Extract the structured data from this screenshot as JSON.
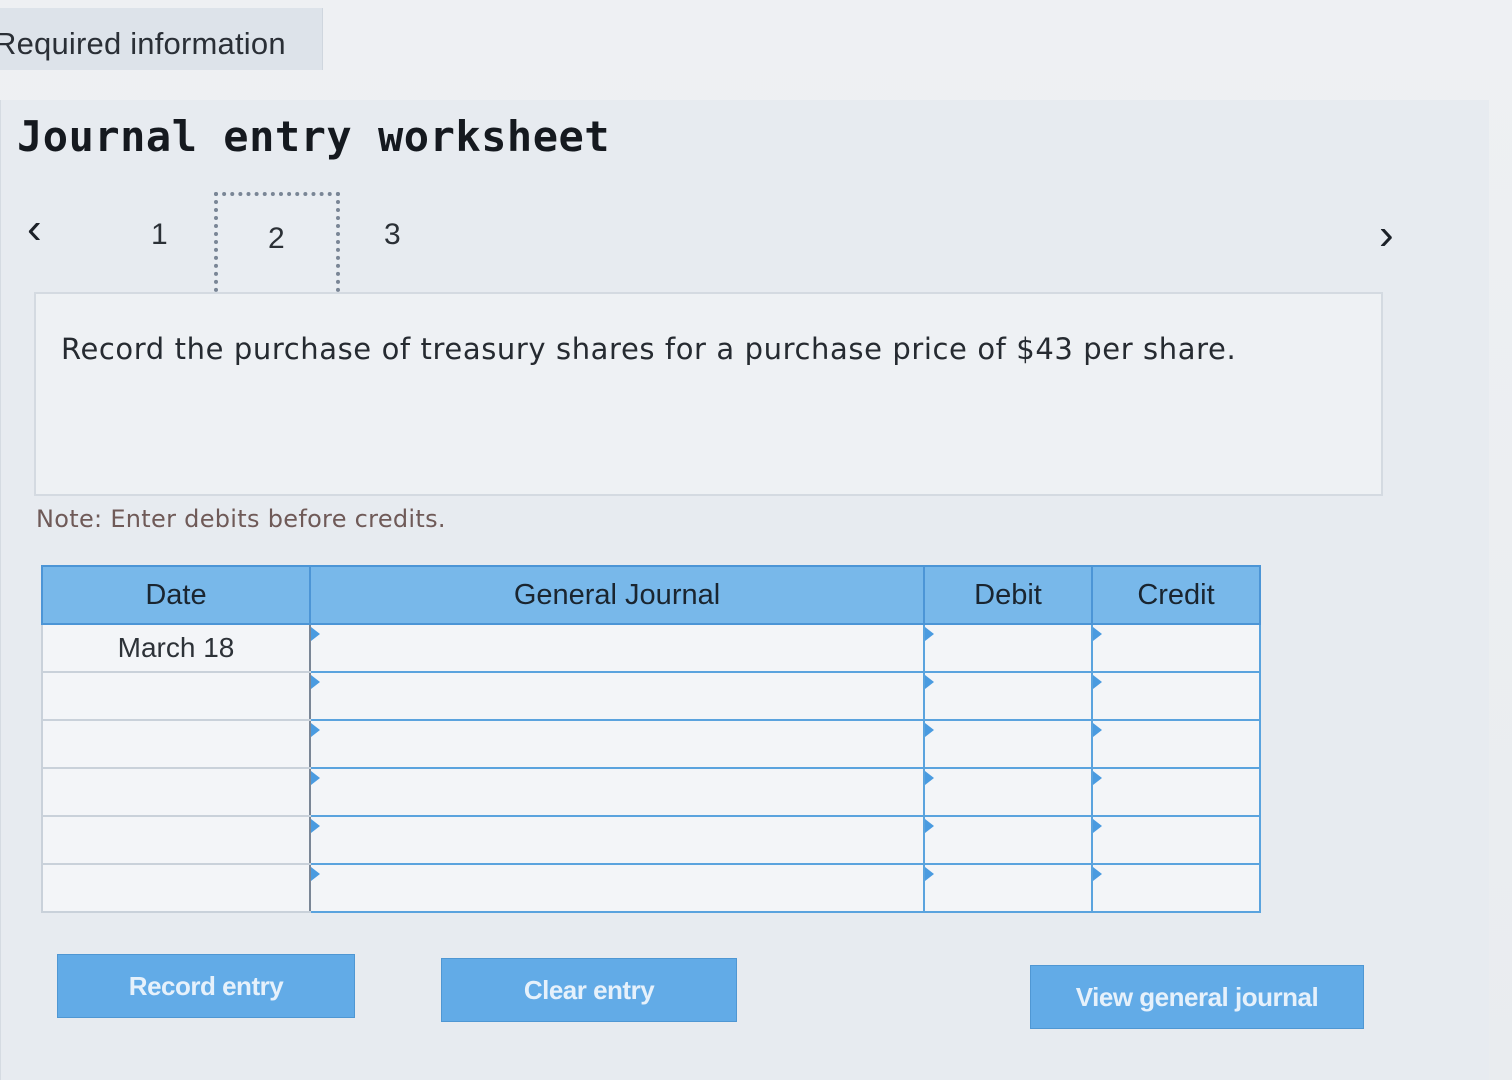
{
  "header": {
    "required_tab_label": "Required information"
  },
  "worksheet": {
    "title": "Journal entry worksheet",
    "pager": {
      "prev_icon": "‹",
      "next_icon": "›",
      "pages": [
        "1",
        "2",
        "3"
      ],
      "current_page": "2"
    },
    "instruction": "Record the purchase of treasury shares for a purchase price of $43 per share.",
    "note": "Note: Enter debits before credits."
  },
  "journal_table": {
    "headers": {
      "date": "Date",
      "general_journal": "General Journal",
      "debit": "Debit",
      "credit": "Credit"
    },
    "rows": [
      {
        "date": "March 18",
        "account": "",
        "debit": "",
        "credit": ""
      },
      {
        "date": "",
        "account": "",
        "debit": "",
        "credit": ""
      },
      {
        "date": "",
        "account": "",
        "debit": "",
        "credit": ""
      },
      {
        "date": "",
        "account": "",
        "debit": "",
        "credit": ""
      },
      {
        "date": "",
        "account": "",
        "debit": "",
        "credit": ""
      },
      {
        "date": "",
        "account": "",
        "debit": "",
        "credit": ""
      }
    ]
  },
  "buttons": {
    "record_entry": "Record entry",
    "clear_entry": "Clear entry",
    "view_general_journal": "View general journal"
  },
  "colors": {
    "accent": "#62abe7",
    "table_header": "#78b8ea",
    "grid_line": "#5aa3de"
  }
}
